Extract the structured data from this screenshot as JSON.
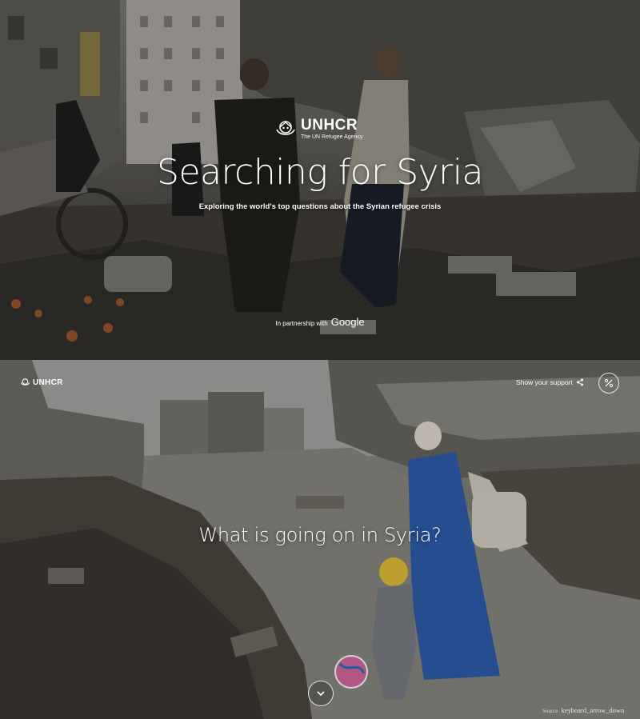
{
  "hero": {
    "brand": {
      "name": "UNHCR",
      "tagline": "The UN Refugee Agency",
      "emblem_icon": "unhcr-emblem-icon"
    },
    "title": "Searching for Syria",
    "subtitle": "Exploring the world's top questions about the Syrian refugee crisis",
    "partnership": {
      "prefix": "In partnership with",
      "partner": "Google"
    }
  },
  "section2": {
    "nav": {
      "logo_text": "UNHCR",
      "support_label": "Show your support",
      "share_icon": "share-icon",
      "toggle_icon": "percent-toggle-icon"
    },
    "question": "What is going on in Syria?",
    "source": {
      "label": "Source",
      "arrow_text": "keyboard_arrow_down"
    },
    "scroll_icon": "chevron-down-icon"
  },
  "colors": {
    "text": "#ffffff",
    "hero_tint": "#5f5c56",
    "section2_sky": "#a9aaa6",
    "woman_dress": "#2f5fb0",
    "child_hat": "#e6c23a"
  }
}
